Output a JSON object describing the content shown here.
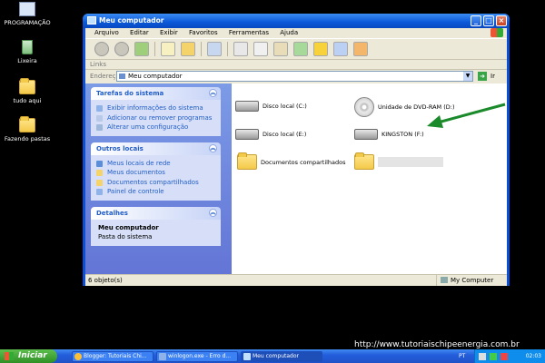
{
  "desktop": {
    "icons": [
      {
        "label": "PROGRAMAÇÃO",
        "icon": "programacao-icon"
      },
      {
        "label": "Lixeira",
        "icon": "recycle-bin-icon"
      },
      {
        "label": "tudo aqui",
        "icon": "folder-icon"
      },
      {
        "label": "Fazendo pastas",
        "icon": "folder-icon"
      }
    ]
  },
  "window": {
    "title": "Meu computador",
    "menu": [
      "Arquivo",
      "Editar",
      "Exibir",
      "Favoritos",
      "Ferramentas",
      "Ajuda"
    ],
    "links_label": "Links",
    "address_label": "Endereço",
    "address_value": "Meu computador",
    "go_label": "Ir",
    "left_pane": {
      "system_tasks": {
        "title": "Tarefas do sistema",
        "items": [
          "Exibir informações do sistema",
          "Adicionar ou remover programas",
          "Alterar uma configuração"
        ]
      },
      "other_places": {
        "title": "Outros locais",
        "items": [
          "Meus locais de rede",
          "Meus documentos",
          "Documentos compartilhados",
          "Painel de controle"
        ]
      },
      "details": {
        "title": "Detalhes",
        "name": "Meu computador",
        "description": "Pasta do sistema"
      }
    },
    "items": [
      {
        "label": "Disco local (C:)",
        "type": "drive"
      },
      {
        "label": "Unidade de DVD-RAM (D:)",
        "type": "dvd"
      },
      {
        "label": "Disco local (E:)",
        "type": "drive"
      },
      {
        "label": "KINGSTON (F:)",
        "type": "drive"
      },
      {
        "label": "Documentos compartilhados",
        "type": "folder"
      },
      {
        "label": "",
        "type": "folder"
      }
    ],
    "status_left": "6 objeto(s)",
    "status_right": "My Computer"
  },
  "taskbar": {
    "start_label": "Iniciar",
    "tasks": [
      "Blogger: Tutoriais Chi...",
      "winlogon.exe - Erro d...",
      "Meu computador"
    ],
    "language": "PT",
    "clock": "02:03"
  },
  "watermark": "http://www.tutoriaischipeenergia.com.br",
  "colors": {
    "title_bar": "#0b58d8",
    "left_pane": "#6f8ae0",
    "arrow": "#1a8a2a"
  }
}
